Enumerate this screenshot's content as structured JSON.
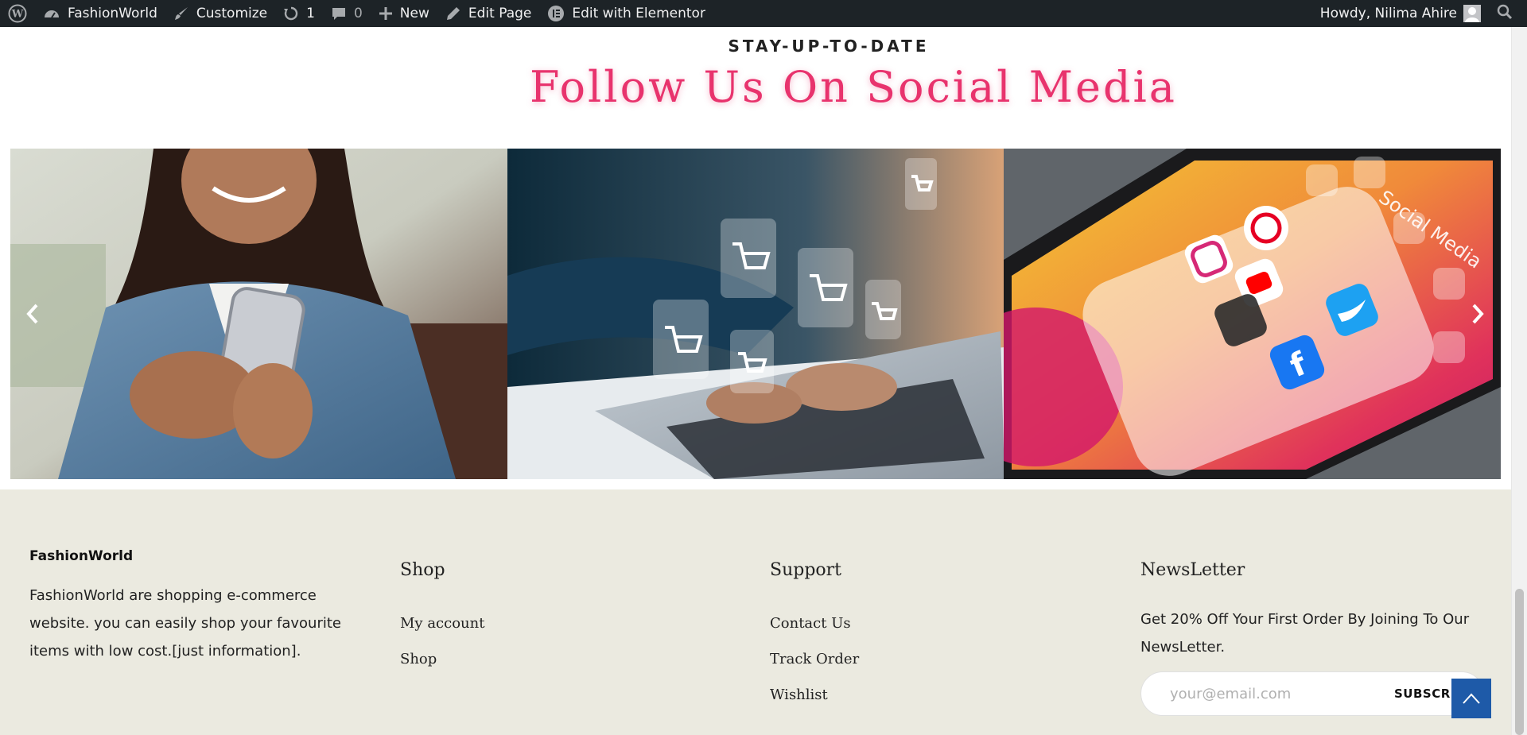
{
  "adminbar": {
    "site_name": "FashionWorld",
    "customize": "Customize",
    "updates_count": "1",
    "comments_count": "0",
    "new": "New",
    "edit_page": "Edit Page",
    "edit_elementor": "Edit with Elementor",
    "howdy": "Howdy, Nilima Ahire"
  },
  "section": {
    "eyebrow": "STAY-UP-TO-DATE",
    "title": "Follow Us On Social Media"
  },
  "gallery": {
    "icons": [
      "chevron-left-icon",
      "chevron-right-icon"
    ]
  },
  "footer": {
    "brand": "FashionWorld",
    "about": "FashionWorld are shopping e-commerce website. you can easily shop your favourite items with low cost.[just information].",
    "shop": {
      "heading": "Shop",
      "links": [
        "My account",
        "Shop"
      ]
    },
    "support": {
      "heading": "Support",
      "links": [
        "Contact Us",
        "Track Order",
        "Wishlist"
      ]
    },
    "newsletter": {
      "heading": "NewsLetter",
      "text": "Get 20% Off Your First Order By Joining To Our NewsLetter.",
      "placeholder": "your@email.com",
      "button": "SUBSCRIBE"
    }
  },
  "colors": {
    "accent": "#e8336d",
    "adminbar": "#1d2327",
    "footer_bg": "#ebeae0",
    "to_top": "#1e5aa8"
  }
}
